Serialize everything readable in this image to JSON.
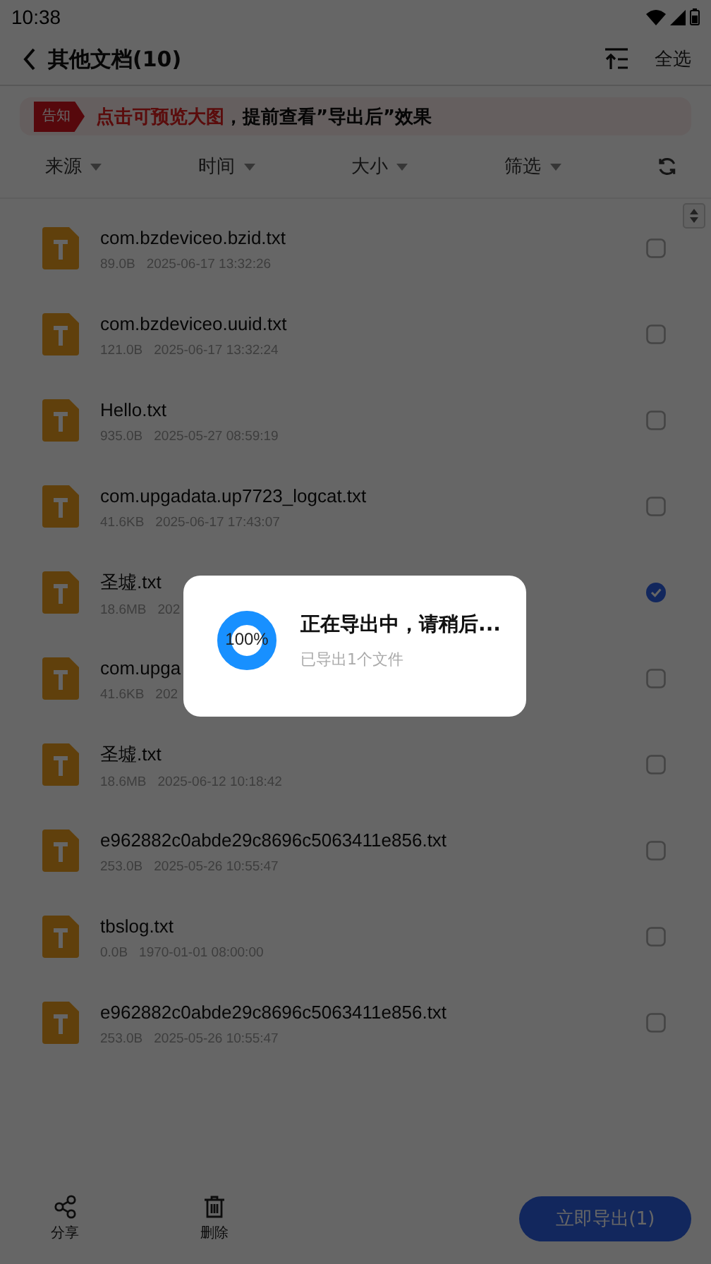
{
  "status_bar": {
    "time": "10:38"
  },
  "header": {
    "title": "其他文档(10)",
    "select_all": "全选"
  },
  "notice": {
    "tag": "告知",
    "highlight": "点击可预览大图",
    "text": "，提前查看”导出后”效果"
  },
  "filters": [
    {
      "label": "来源"
    },
    {
      "label": "时间"
    },
    {
      "label": "大小"
    },
    {
      "label": "筛选"
    }
  ],
  "files": [
    {
      "name": "com.bzdeviceo.bzid.txt",
      "size": "89.0B",
      "date": "2025-06-17 13:32:26",
      "checked": false
    },
    {
      "name": "com.bzdeviceo.uuid.txt",
      "size": "121.0B",
      "date": "2025-06-17 13:32:24",
      "checked": false
    },
    {
      "name": "Hello.txt",
      "size": "935.0B",
      "date": "2025-05-27 08:59:19",
      "checked": false
    },
    {
      "name": "com.upgadata.up7723_logcat.txt",
      "size": "41.6KB",
      "date": "2025-06-17 17:43:07",
      "checked": false
    },
    {
      "name": "圣墟.txt",
      "size": "18.6MB",
      "date": "202",
      "checked": true
    },
    {
      "name": "com.upga",
      "size": "41.6KB",
      "date": "202",
      "checked": false
    },
    {
      "name": "圣墟.txt",
      "size": "18.6MB",
      "date": "2025-06-12 10:18:42",
      "checked": false
    },
    {
      "name": "e962882c0abde29c8696c5063411e856.txt",
      "size": "253.0B",
      "date": "2025-05-26 10:55:47",
      "checked": false
    },
    {
      "name": "tbslog.txt",
      "size": "0.0B",
      "date": "1970-01-01 08:00:00",
      "checked": false
    },
    {
      "name": "e962882c0abde29c8696c5063411e856.txt",
      "size": "253.0B",
      "date": "2025-05-26 10:55:47",
      "checked": false
    }
  ],
  "bottom_bar": {
    "actions": [
      {
        "kind": "share",
        "label": "分享"
      },
      {
        "kind": "delete",
        "label": "删除"
      }
    ],
    "export_button": "立即导出(1)"
  },
  "dialog": {
    "percent": "100%",
    "level": 1,
    "title": "正在导出中，请稍后...",
    "subtitle": "已导出1个文件"
  }
}
